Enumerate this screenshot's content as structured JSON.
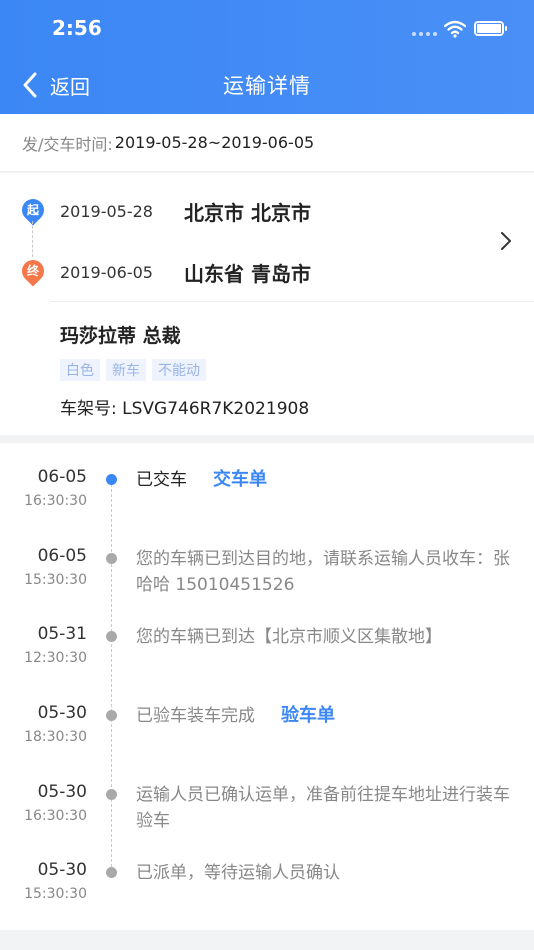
{
  "status_bar": {
    "time": "2:56"
  },
  "nav": {
    "back_label": "返回",
    "title": "运输详情"
  },
  "delivery_time": {
    "label": "发/交车时间:",
    "value": "2019-05-28~2019-06-05"
  },
  "route": {
    "start": {
      "badge": "起",
      "date": "2019-05-28",
      "place": "北京市 北京市",
      "color": "#3b87f5"
    },
    "end": {
      "badge": "终",
      "date": "2019-06-05",
      "place": "山东省 青岛市",
      "color": "#f5774a"
    }
  },
  "vehicle": {
    "name": "玛莎拉蒂 总裁",
    "tags": [
      "白色",
      "新车",
      "不能动"
    ],
    "vin_label": "车架号:",
    "vin_value": "LSVG746R7K2021908"
  },
  "timeline": [
    {
      "date": "06-05",
      "time": "16:30:30",
      "text": "已交车",
      "link": "交车单",
      "active": true
    },
    {
      "date": "06-05",
      "time": "15:30:30",
      "text": "您的车辆已到达目的地，请联系运输人员收车：张哈哈 15010451526",
      "link": "",
      "active": false
    },
    {
      "date": "05-31",
      "time": "12:30:30",
      "text": "您的车辆已到达【北京市顺义区集散地】",
      "link": "",
      "active": false
    },
    {
      "date": "05-30",
      "time": "18:30:30",
      "text": "已验车装车完成",
      "link": "验车单",
      "active": false
    },
    {
      "date": "05-30",
      "time": "16:30:30",
      "text": "运输人员已确认运单，准备前往提车地址进行装车验车",
      "link": "",
      "active": false
    },
    {
      "date": "05-30",
      "time": "15:30:30",
      "text": "已派单，等待运输人员确认",
      "link": "",
      "active": false
    }
  ],
  "colors": {
    "accent": "#3b87f5",
    "muted": "#888888"
  }
}
